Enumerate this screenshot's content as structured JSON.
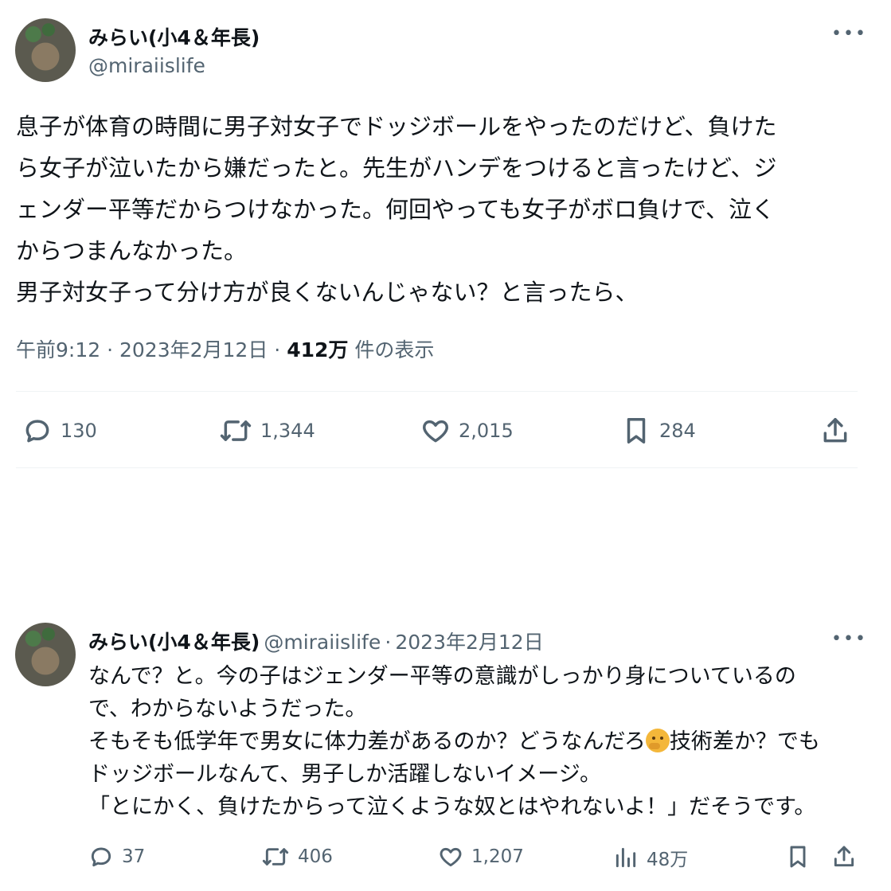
{
  "main_tweet": {
    "author_name": "みらい(小4＆年長)",
    "author_handle": "@miraiislife",
    "more_label": "•••",
    "text_lines": [
      "息子が体育の時間に男子対女子でドッジボールをやったのだけど、負けた",
      "ら女子が泣いたから嫌だったと。先生がハンデをつけると言ったけど、ジ",
      "ェンダー平等だからつけなかった。何回やっても女子がボロ負けで、泣く",
      "からつまんなかった。",
      "男子対女子って分け方が良くないんじゃない？と言ったら、"
    ],
    "time": "午前9:12",
    "date": "2023年2月12日",
    "views_count": "412万",
    "views_label": "件の表示",
    "separator": "·",
    "actions": {
      "reply_count": "130",
      "retweet_count": "1,344",
      "like_count": "2,015",
      "bookmark_count": "284"
    }
  },
  "reply_tweet": {
    "author_name": "みらい(小4＆年長)",
    "author_handle": "@miraiislife",
    "separator": "·",
    "date": "2023年2月12日",
    "more_label": "•••",
    "lines": {
      "l1": "なんで？と。今の子はジェンダー平等の意識がしっかり身についているの",
      "l2": "で、わからないようだった。",
      "l3a": "そもそも低学年で男女に体力差があるのか？どうなんだろ",
      "l3b": "技術差か？でも",
      "l4": "ドッジボールなんて、男子しか活躍しないイメージ。",
      "l5": "「とにかく、負けたからって泣くような奴とはやれないよ！」だそうです。"
    },
    "emoji_name": "thinking-face",
    "actions": {
      "reply_count": "37",
      "retweet_count": "406",
      "like_count": "1,207",
      "views_count": "48万"
    }
  },
  "colors": {
    "text": "#0f1419",
    "secondary": "#536471",
    "divider": "#eff3f4"
  }
}
